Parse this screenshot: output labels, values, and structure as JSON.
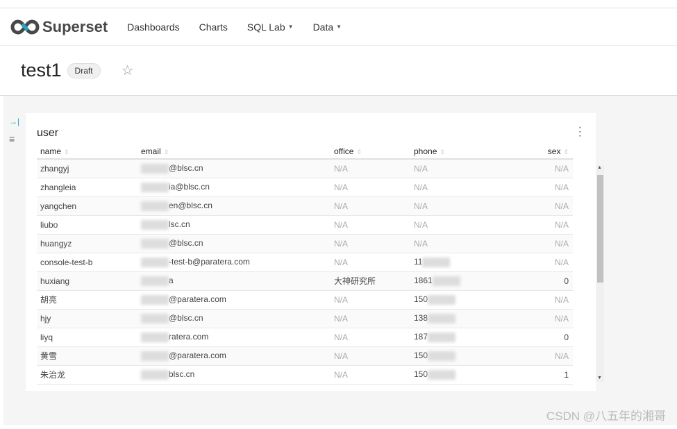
{
  "nav": {
    "brand": "Superset",
    "items": [
      {
        "label": "Dashboards"
      },
      {
        "label": "Charts"
      },
      {
        "label": "SQL Lab",
        "dropdown": true
      },
      {
        "label": "Data",
        "dropdown": true
      }
    ]
  },
  "header": {
    "title": "test1",
    "badge": "Draft"
  },
  "chart": {
    "title": "user",
    "columns": [
      "name",
      "email",
      "office",
      "phone",
      "sex"
    ],
    "rows": [
      [
        "zhangyj",
        "@blsc.cn",
        "N/A",
        "N/A",
        "N/A"
      ],
      [
        "zhangleia",
        "ia@blsc.cn",
        "N/A",
        "N/A",
        "N/A"
      ],
      [
        "yangchen",
        "en@blsc.cn",
        "N/A",
        "N/A",
        "N/A"
      ],
      [
        "liubo",
        "lsc.cn",
        "N/A",
        "N/A",
        "N/A"
      ],
      [
        "huangyz",
        "@blsc.cn",
        "N/A",
        "N/A",
        "N/A"
      ],
      [
        "console-test-b",
        "-test-b@paratera.com",
        "N/A",
        "11",
        "N/A"
      ],
      [
        "huxiang",
        "a",
        "大神研究所",
        "1861",
        "0"
      ],
      [
        "胡亮",
        "@paratera.com",
        "N/A",
        "150",
        "N/A"
      ],
      [
        "hjy",
        "@blsc.cn",
        "N/A",
        "138",
        "N/A"
      ],
      [
        "liyq",
        "ratera.com",
        "N/A",
        "187",
        "0"
      ],
      [
        "黄雪",
        "@paratera.com",
        "N/A",
        "150",
        "N/A"
      ],
      [
        "朱治龙",
        "blsc.cn",
        "N/A",
        "150",
        "1"
      ]
    ]
  },
  "watermark": "CSDN @八五年的湘哥",
  "colors": {
    "accent": "#20a7c9",
    "na": "#aaaaaa"
  }
}
